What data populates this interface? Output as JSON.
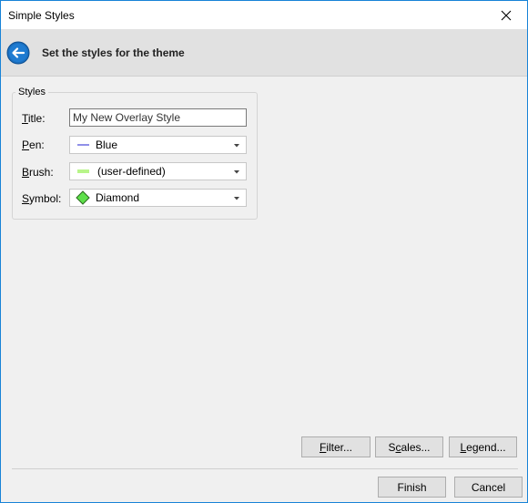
{
  "window": {
    "title": "Simple Styles"
  },
  "header": {
    "heading": "Set the styles for the theme"
  },
  "group": {
    "legend": "Styles",
    "title_label": {
      "key": "T",
      "rest": "itle:"
    },
    "title_value": "My New Overlay Style",
    "pen_label": {
      "key": "P",
      "rest": "en:"
    },
    "pen_value": "Blue",
    "pen_color": "#6b6be0",
    "brush_label": {
      "key": "B",
      "rest": "rush:"
    },
    "brush_value": "(user-defined)",
    "brush_color": "#b8f58a",
    "symbol_label": {
      "key": "S",
      "rest": "ymbol:"
    },
    "symbol_value": "Diamond",
    "symbol_color": "#5ee04a"
  },
  "buttons": {
    "filter": {
      "key": "F",
      "rest": "ilter..."
    },
    "scales": {
      "pre": "S",
      "key": "c",
      "rest": "ales..."
    },
    "legend": {
      "key": "L",
      "rest": "egend..."
    },
    "finish": "Finish",
    "cancel": "Cancel"
  },
  "colors": {
    "accent": "#1883d7"
  }
}
